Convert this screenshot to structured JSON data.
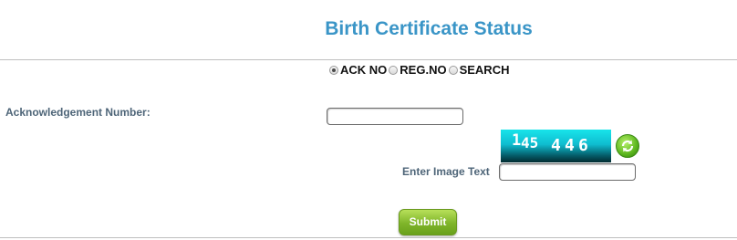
{
  "header": {
    "title": "Birth Certificate Status"
  },
  "search_type": {
    "options": [
      {
        "label": "ACK NO",
        "checked": true
      },
      {
        "label": "REG.NO",
        "checked": false
      },
      {
        "label": "SEARCH",
        "checked": false
      }
    ]
  },
  "form": {
    "ack_label": "Acknowledgement Number:",
    "ack_value": "",
    "captcha_text": [
      "1",
      "45",
      "4",
      "4",
      "6"
    ],
    "image_text_label": "Enter Image Text",
    "image_text_value": "",
    "submit_label": "Submit"
  },
  "colors": {
    "title": "#3a95c7",
    "label": "#4e6578",
    "submit": "#7fb52a",
    "captcha": "#0fbdd0"
  },
  "icons": {
    "refresh": "refresh-icon"
  }
}
